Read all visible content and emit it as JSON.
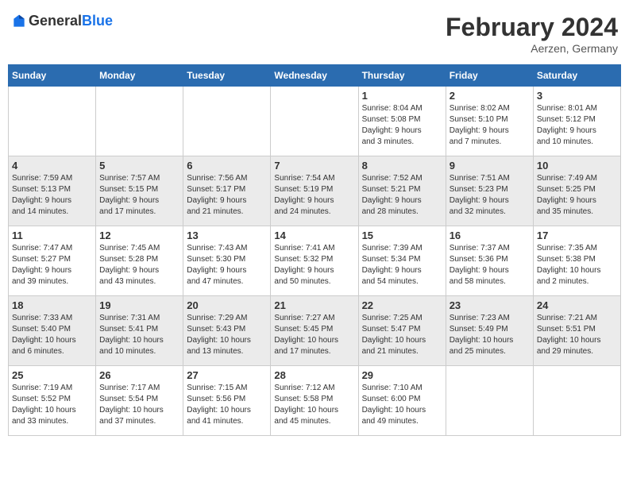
{
  "header": {
    "logo_general": "General",
    "logo_blue": "Blue",
    "month_year": "February 2024",
    "location": "Aerzen, Germany"
  },
  "weekdays": [
    "Sunday",
    "Monday",
    "Tuesday",
    "Wednesday",
    "Thursday",
    "Friday",
    "Saturday"
  ],
  "rows": [
    {
      "style": "white",
      "cells": [
        {
          "day": "",
          "info": ""
        },
        {
          "day": "",
          "info": ""
        },
        {
          "day": "",
          "info": ""
        },
        {
          "day": "",
          "info": ""
        },
        {
          "day": "1",
          "info": "Sunrise: 8:04 AM\nSunset: 5:08 PM\nDaylight: 9 hours\nand 3 minutes."
        },
        {
          "day": "2",
          "info": "Sunrise: 8:02 AM\nSunset: 5:10 PM\nDaylight: 9 hours\nand 7 minutes."
        },
        {
          "day": "3",
          "info": "Sunrise: 8:01 AM\nSunset: 5:12 PM\nDaylight: 9 hours\nand 10 minutes."
        }
      ]
    },
    {
      "style": "gray",
      "cells": [
        {
          "day": "4",
          "info": "Sunrise: 7:59 AM\nSunset: 5:13 PM\nDaylight: 9 hours\nand 14 minutes."
        },
        {
          "day": "5",
          "info": "Sunrise: 7:57 AM\nSunset: 5:15 PM\nDaylight: 9 hours\nand 17 minutes."
        },
        {
          "day": "6",
          "info": "Sunrise: 7:56 AM\nSunset: 5:17 PM\nDaylight: 9 hours\nand 21 minutes."
        },
        {
          "day": "7",
          "info": "Sunrise: 7:54 AM\nSunset: 5:19 PM\nDaylight: 9 hours\nand 24 minutes."
        },
        {
          "day": "8",
          "info": "Sunrise: 7:52 AM\nSunset: 5:21 PM\nDaylight: 9 hours\nand 28 minutes."
        },
        {
          "day": "9",
          "info": "Sunrise: 7:51 AM\nSunset: 5:23 PM\nDaylight: 9 hours\nand 32 minutes."
        },
        {
          "day": "10",
          "info": "Sunrise: 7:49 AM\nSunset: 5:25 PM\nDaylight: 9 hours\nand 35 minutes."
        }
      ]
    },
    {
      "style": "white",
      "cells": [
        {
          "day": "11",
          "info": "Sunrise: 7:47 AM\nSunset: 5:27 PM\nDaylight: 9 hours\nand 39 minutes."
        },
        {
          "day": "12",
          "info": "Sunrise: 7:45 AM\nSunset: 5:28 PM\nDaylight: 9 hours\nand 43 minutes."
        },
        {
          "day": "13",
          "info": "Sunrise: 7:43 AM\nSunset: 5:30 PM\nDaylight: 9 hours\nand 47 minutes."
        },
        {
          "day": "14",
          "info": "Sunrise: 7:41 AM\nSunset: 5:32 PM\nDaylight: 9 hours\nand 50 minutes."
        },
        {
          "day": "15",
          "info": "Sunrise: 7:39 AM\nSunset: 5:34 PM\nDaylight: 9 hours\nand 54 minutes."
        },
        {
          "day": "16",
          "info": "Sunrise: 7:37 AM\nSunset: 5:36 PM\nDaylight: 9 hours\nand 58 minutes."
        },
        {
          "day": "17",
          "info": "Sunrise: 7:35 AM\nSunset: 5:38 PM\nDaylight: 10 hours\nand 2 minutes."
        }
      ]
    },
    {
      "style": "gray",
      "cells": [
        {
          "day": "18",
          "info": "Sunrise: 7:33 AM\nSunset: 5:40 PM\nDaylight: 10 hours\nand 6 minutes."
        },
        {
          "day": "19",
          "info": "Sunrise: 7:31 AM\nSunset: 5:41 PM\nDaylight: 10 hours\nand 10 minutes."
        },
        {
          "day": "20",
          "info": "Sunrise: 7:29 AM\nSunset: 5:43 PM\nDaylight: 10 hours\nand 13 minutes."
        },
        {
          "day": "21",
          "info": "Sunrise: 7:27 AM\nSunset: 5:45 PM\nDaylight: 10 hours\nand 17 minutes."
        },
        {
          "day": "22",
          "info": "Sunrise: 7:25 AM\nSunset: 5:47 PM\nDaylight: 10 hours\nand 21 minutes."
        },
        {
          "day": "23",
          "info": "Sunrise: 7:23 AM\nSunset: 5:49 PM\nDaylight: 10 hours\nand 25 minutes."
        },
        {
          "day": "24",
          "info": "Sunrise: 7:21 AM\nSunset: 5:51 PM\nDaylight: 10 hours\nand 29 minutes."
        }
      ]
    },
    {
      "style": "white",
      "cells": [
        {
          "day": "25",
          "info": "Sunrise: 7:19 AM\nSunset: 5:52 PM\nDaylight: 10 hours\nand 33 minutes."
        },
        {
          "day": "26",
          "info": "Sunrise: 7:17 AM\nSunset: 5:54 PM\nDaylight: 10 hours\nand 37 minutes."
        },
        {
          "day": "27",
          "info": "Sunrise: 7:15 AM\nSunset: 5:56 PM\nDaylight: 10 hours\nand 41 minutes."
        },
        {
          "day": "28",
          "info": "Sunrise: 7:12 AM\nSunset: 5:58 PM\nDaylight: 10 hours\nand 45 minutes."
        },
        {
          "day": "29",
          "info": "Sunrise: 7:10 AM\nSunset: 6:00 PM\nDaylight: 10 hours\nand 49 minutes."
        },
        {
          "day": "",
          "info": ""
        },
        {
          "day": "",
          "info": ""
        }
      ]
    }
  ]
}
